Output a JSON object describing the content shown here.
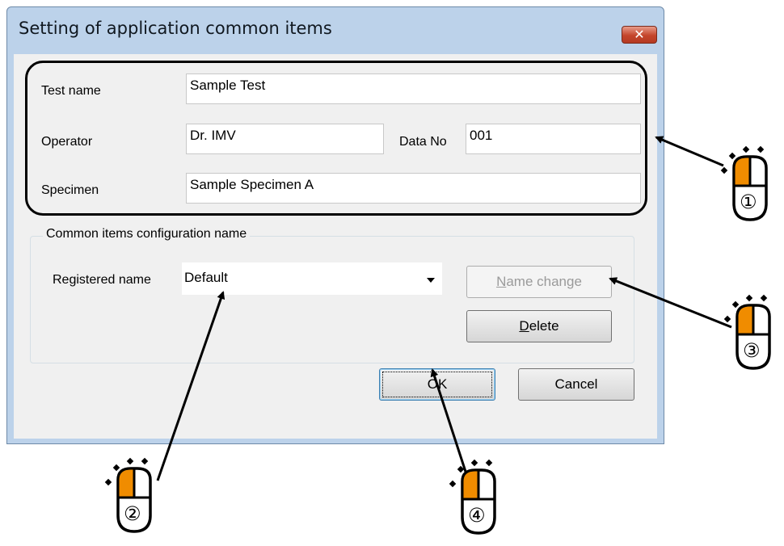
{
  "dialog": {
    "title": "Setting of application common items",
    "close_label": "✕"
  },
  "fields": {
    "test_name_label": "Test name",
    "test_name_value": "Sample Test",
    "operator_label": "Operator",
    "operator_value": "Dr. IMV",
    "data_no_label": "Data No",
    "data_no_value": "001",
    "specimen_label": "Specimen",
    "specimen_value": "Sample Specimen A"
  },
  "config": {
    "group_title": "Common items configuration name",
    "registered_name_label": "Registered name",
    "registered_name_value": "Default",
    "name_change": {
      "mnemonic": "N",
      "rest": "ame change"
    },
    "delete": {
      "mnemonic": "D",
      "rest": "elete"
    }
  },
  "footer": {
    "ok_label": "OK",
    "cancel_label": "Cancel"
  },
  "callouts": {
    "one": "①",
    "two": "②",
    "three": "③",
    "four": "④"
  },
  "colors": {
    "mouse_button": "#f08c00",
    "window_frame": "#bcd2ea"
  }
}
